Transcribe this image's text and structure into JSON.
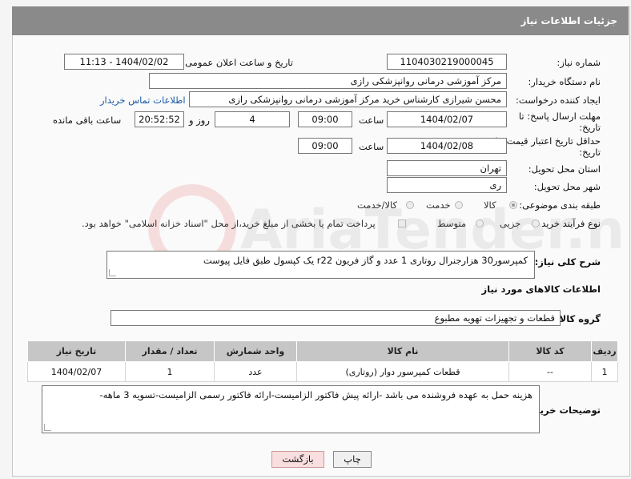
{
  "header": {
    "title": "جزئیات اطلاعات نیاز"
  },
  "labels": {
    "need_number": "شماره نیاز:",
    "announce_datetime": "تاریخ و ساعت اعلان عمومی:",
    "buyer_org": "نام دستگاه خریدار:",
    "requester": "ایجاد کننده درخواست:",
    "deadline": "مهلت ارسال پاسخ: تا تاریخ:",
    "min_validity": "حداقل تاریخ اعتبار قیمت: تا تاریخ:",
    "hour": "ساعت",
    "days_and": "روز و",
    "time_remaining": "ساعت باقی مانده",
    "province": "استان محل تحویل:",
    "city": "شهر محل تحویل:",
    "category": "طبقه بندی موضوعی:",
    "process_type": "نوع فرآیند خرید :",
    "description": "شرح کلی نیاز:",
    "goods_info": "اطلاعات کالاهای مورد نیاز",
    "goods_group": "گروه کالا:",
    "buyer_notes": "توضیحات خریدار:"
  },
  "fields": {
    "need_number": "1104030219000045",
    "announce_datetime": "1404/02/02 - 11:13",
    "buyer_org": "مرکز آموزشی درمانی روانپزشکی رازی",
    "requester": "محسن شیرازی کارشناس خرید مرکز آموزشی درمانی روانپزشکی رازی",
    "buyer_contact_link": "اطلاعات تماس خریدار",
    "deadline_date": "1404/02/07",
    "deadline_time": "09:00",
    "days": "4",
    "remaining_time": "20:52:52",
    "validity_date": "1404/02/08",
    "validity_time": "09:00",
    "province": "تهران",
    "city": "ری",
    "description": "کمپرسور30 هزارجنرال روتاری 1 عدد و گاز فریون r22 یک کپسول طبق فایل پیوست",
    "goods_group": "قطعات و تجهیزات تهویه مطبوع",
    "buyer_notes": "هزینه حمل به عهده فروشنده می باشد -ارائه پیش فاکتور الزامیست-ارائه فاکتور رسمی الزامیست-تسویه 3 ماهه-"
  },
  "category_options": [
    {
      "label": "کالا",
      "selected": true
    },
    {
      "label": "خدمت",
      "selected": false
    },
    {
      "label": "کالا/خدمت",
      "selected": false
    }
  ],
  "process_options": [
    {
      "label": "جزیی",
      "selected": false
    },
    {
      "label": "متوسط",
      "selected": false
    }
  ],
  "payment_note": "پرداخت تمام یا بخشی از مبلغ خرید،از محل \"اسناد خزانه اسلامی\" خواهد بود.",
  "table": {
    "headers": [
      "ردیف",
      "کد کالا",
      "نام کالا",
      "واحد شمارش",
      "تعداد / مقدار",
      "تاریخ نیاز"
    ],
    "rows": [
      [
        "1",
        "--",
        "قطعات کمپرسور دوار (روتاری)",
        "عدد",
        "1",
        "1404/02/07"
      ]
    ]
  },
  "buttons": {
    "print": "چاپ",
    "back": "بازگشت"
  },
  "watermark": "AriaTender.net"
}
